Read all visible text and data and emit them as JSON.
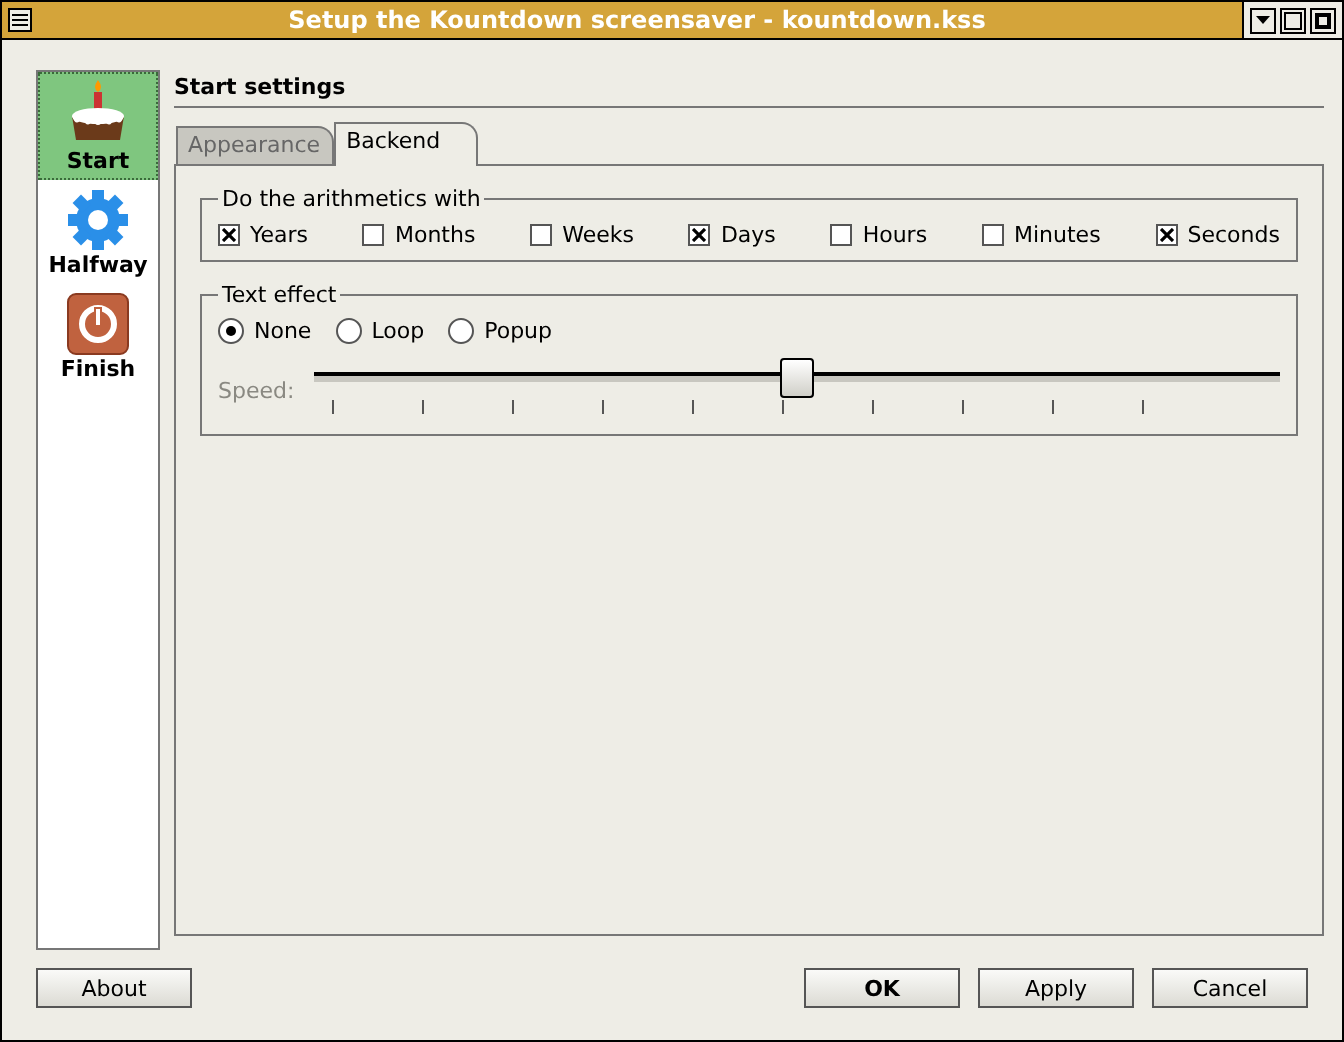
{
  "window": {
    "title": "Setup the Kountdown screensaver - kountdown.kss"
  },
  "sidebar": {
    "items": [
      {
        "label": "Start",
        "kind": "cake",
        "selected": true
      },
      {
        "label": "Halfway",
        "kind": "gear",
        "selected": false
      },
      {
        "label": "Finish",
        "kind": "power",
        "selected": false
      }
    ]
  },
  "page_title": "Start settings",
  "tabs": [
    {
      "label": "Appearance",
      "selected": false
    },
    {
      "label": "Backend",
      "selected": true
    }
  ],
  "arithmetics": {
    "title": "Do the arithmetics with",
    "options": [
      {
        "label": "Years",
        "checked": true
      },
      {
        "label": "Months",
        "checked": false
      },
      {
        "label": "Weeks",
        "checked": false
      },
      {
        "label": "Days",
        "checked": true
      },
      {
        "label": "Hours",
        "checked": false
      },
      {
        "label": "Minutes",
        "checked": false
      },
      {
        "label": "Seconds",
        "checked": true
      }
    ]
  },
  "text_effect": {
    "title": "Text effect",
    "options": [
      {
        "label": "None",
        "selected": true
      },
      {
        "label": "Loop",
        "selected": false
      },
      {
        "label": "Popup",
        "selected": false
      }
    ],
    "speed": {
      "label": "Speed:",
      "disabled": true,
      "level": 0.5
    }
  },
  "buttons": [
    {
      "label": "About",
      "default": false
    },
    {
      "label": "OK",
      "default": true
    },
    {
      "label": "Apply",
      "default": false
    },
    {
      "label": "Cancel",
      "default": false
    }
  ]
}
